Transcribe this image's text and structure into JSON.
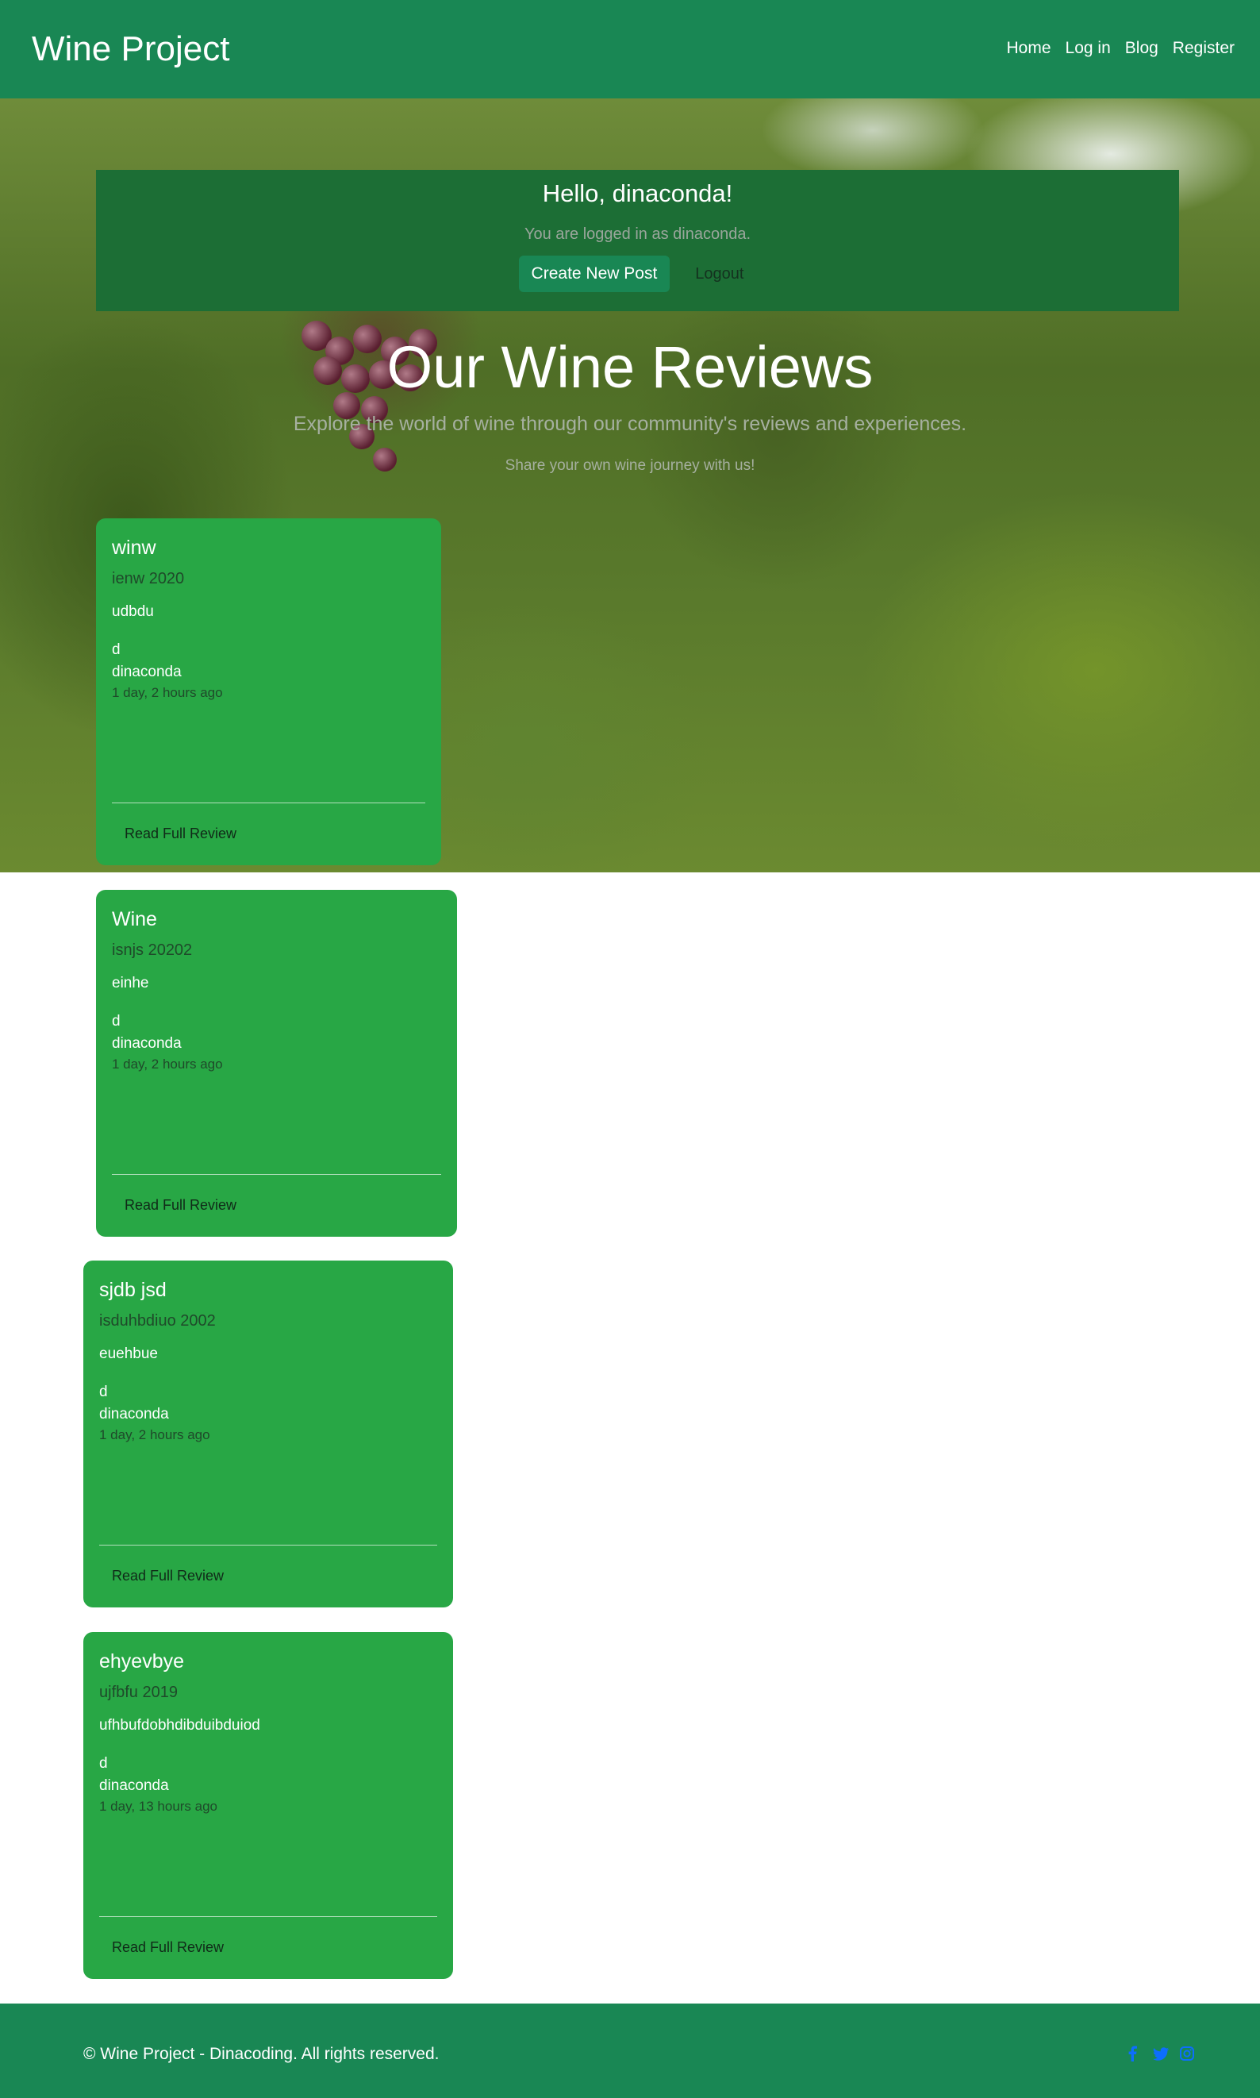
{
  "header": {
    "brand": "Wine Project",
    "nav": [
      "Home",
      "Log in",
      "Blog",
      "Register"
    ]
  },
  "welcome": {
    "greeting": "Hello, dinaconda!",
    "status": "You are logged in as dinaconda.",
    "create_label": "Create New Post",
    "logout_label": "Logout"
  },
  "hero": {
    "title": "Our Wine Reviews",
    "subtitle": "Explore the world of wine through our community's reviews and experiences.",
    "note": "Share your own wine journey with us!"
  },
  "reviews": [
    {
      "title": "winw",
      "subtitle": "ienw 2020",
      "text": "udbdu",
      "d": "d",
      "author": "dinaconda",
      "time": "1 day, 2 hours ago",
      "link": "Read Full Review"
    },
    {
      "title": "Wine",
      "subtitle": "isnjs 20202",
      "text": "einhe",
      "d": "d",
      "author": "dinaconda",
      "time": "1 day, 2 hours ago",
      "link": "Read Full Review"
    },
    {
      "title": "sjdb jsd",
      "subtitle": "isduhbdiuo 2002",
      "text": "euehbue",
      "d": "d",
      "author": "dinaconda",
      "time": "1 day, 2 hours ago",
      "link": "Read Full Review"
    },
    {
      "title": "ehyevbye",
      "subtitle": "ujfbfu 2019",
      "text": "ufhbufdobhdibduibduiod",
      "d": "d",
      "author": "dinaconda",
      "time": "1 day, 13 hours ago",
      "link": "Read Full Review"
    }
  ],
  "footer": {
    "copyright": "© Wine Project - Dinacoding. All rights reserved.",
    "social_icons": [
      "facebook-icon",
      "twitter-icon",
      "instagram-icon"
    ]
  },
  "colors": {
    "header_bg": "#198754",
    "card_bg": "#28a745",
    "welcome_bg": "#1c6e35",
    "social_icon": "#0d6efd"
  }
}
